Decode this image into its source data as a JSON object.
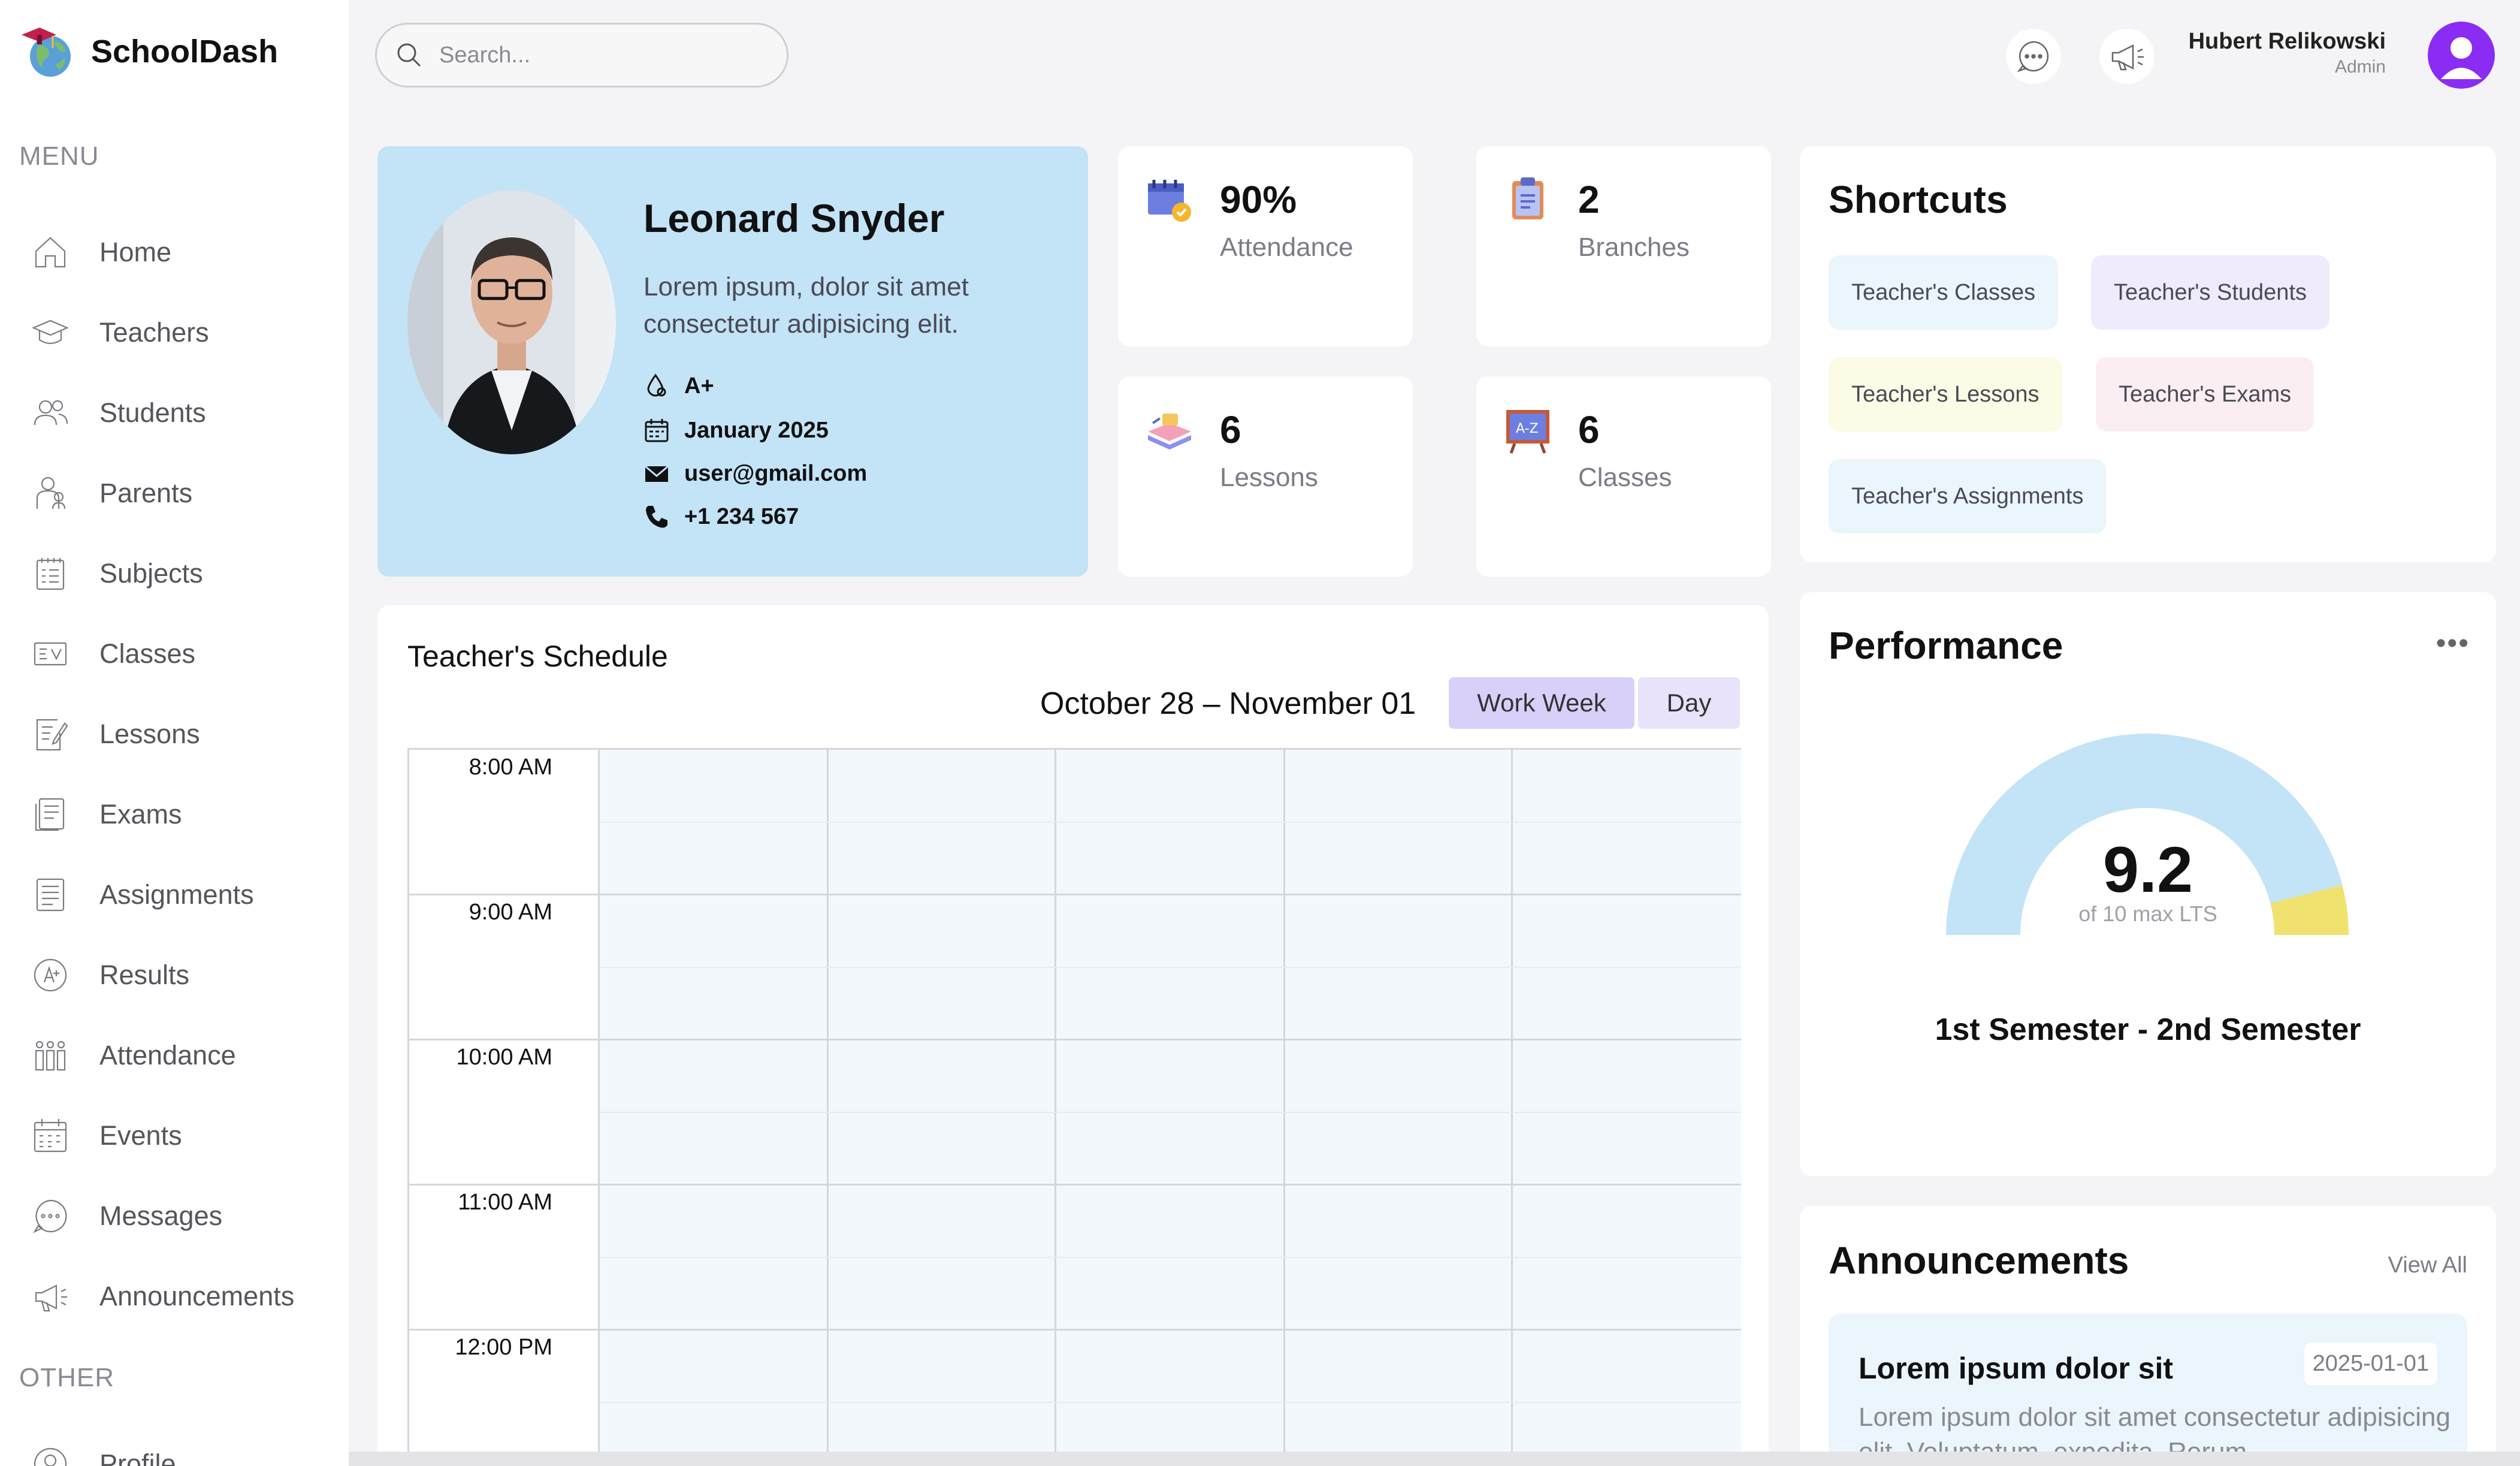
{
  "app": {
    "name": "SchoolDash"
  },
  "sidebar": {
    "menu_label": "MENU",
    "other_label": "OTHER",
    "items": [
      {
        "label": "Home",
        "icon": "home-icon"
      },
      {
        "label": "Teachers",
        "icon": "teacher-icon"
      },
      {
        "label": "Students",
        "icon": "students-icon"
      },
      {
        "label": "Parents",
        "icon": "parents-icon"
      },
      {
        "label": "Subjects",
        "icon": "subjects-icon"
      },
      {
        "label": "Classes",
        "icon": "classes-icon"
      },
      {
        "label": "Lessons",
        "icon": "lessons-icon"
      },
      {
        "label": "Exams",
        "icon": "exams-icon"
      },
      {
        "label": "Assignments",
        "icon": "assignments-icon"
      },
      {
        "label": "Results",
        "icon": "results-icon"
      },
      {
        "label": "Attendance",
        "icon": "attendance-icon"
      },
      {
        "label": "Events",
        "icon": "calendar-icon"
      },
      {
        "label": "Messages",
        "icon": "message-icon"
      },
      {
        "label": "Announcements",
        "icon": "megaphone-icon"
      }
    ],
    "other_items": [
      {
        "label": "Profile",
        "icon": "profile-icon"
      }
    ]
  },
  "topbar": {
    "search_placeholder": "Search...",
    "user_name": "Hubert Relikowski",
    "user_role": "Admin"
  },
  "profile": {
    "name": "Leonard Snyder",
    "description": "Lorem ipsum, dolor sit amet consectetur adipisicing elit.",
    "blood_type": "A+",
    "date": "January 2025",
    "email": "user@gmail.com",
    "phone": "+1 234 567"
  },
  "stats": [
    {
      "value": "90%",
      "label": "Attendance",
      "icon": "attendance-stat-icon"
    },
    {
      "value": "2",
      "label": "Branches",
      "icon": "branches-stat-icon"
    },
    {
      "value": "6",
      "label": "Lessons",
      "icon": "lessons-stat-icon"
    },
    {
      "value": "6",
      "label": "Classes",
      "icon": "classes-stat-icon"
    }
  ],
  "shortcuts": {
    "title": "Shortcuts",
    "items": [
      {
        "label": "Teacher's Classes",
        "color": "#eaf5fc"
      },
      {
        "label": "Teacher's Students",
        "color": "#efeafc"
      },
      {
        "label": "Teacher's Lessons",
        "color": "#fbfbe6"
      },
      {
        "label": "Teacher's Exams",
        "color": "#fbeef2"
      },
      {
        "label": "Teacher's Assignments",
        "color": "#eaf5fc"
      }
    ]
  },
  "schedule": {
    "title": "Teacher's Schedule",
    "range": "October 28 – November 01",
    "views": [
      "Work Week",
      "Day"
    ],
    "active_view": "Work Week",
    "times": [
      "8:00 AM",
      "9:00 AM",
      "10:00 AM",
      "11:00 AM",
      "12:00 PM"
    ]
  },
  "performance": {
    "title": "Performance",
    "value": "9.2",
    "subtitle": "of 10 max LTS",
    "caption": "1st Semester - 2nd Semester",
    "fraction": 0.92,
    "colors": {
      "main": "#c3e3f7",
      "rest": "#f0e26e"
    }
  },
  "announcements": {
    "title": "Announcements",
    "view_all": "View All",
    "items": [
      {
        "title": "Lorem ipsum dolor sit",
        "date": "2025-01-01",
        "text": "Lorem ipsum dolor sit amet consectetur adipisicing elit. Voluptatum, expedita. Rerum"
      }
    ]
  },
  "colors": {
    "accent": "#8b2cf5",
    "profile_bg": "#c3e3f7",
    "active_view_bg": "#d9d0fa"
  }
}
